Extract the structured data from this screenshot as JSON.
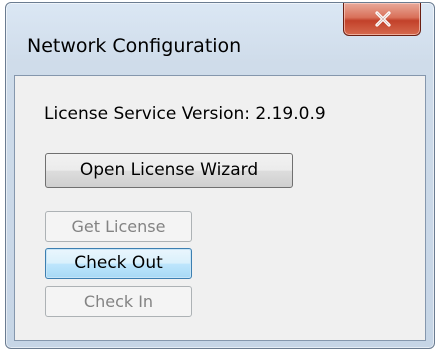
{
  "window": {
    "title": "Network Configuration",
    "close_icon": "close-icon"
  },
  "content": {
    "version_text": "License Service Version: 2.19.0.9",
    "buttons": {
      "open_wizard": "Open License Wizard",
      "get_license": "Get License",
      "check_out": "Check Out",
      "check_in": "Check In"
    },
    "states": {
      "get_license": "disabled",
      "check_out": "focused",
      "check_in": "disabled"
    }
  },
  "colors": {
    "close_button": "#c8462e",
    "focus_border": "#3c7fb1",
    "disabled_text": "#838383"
  }
}
